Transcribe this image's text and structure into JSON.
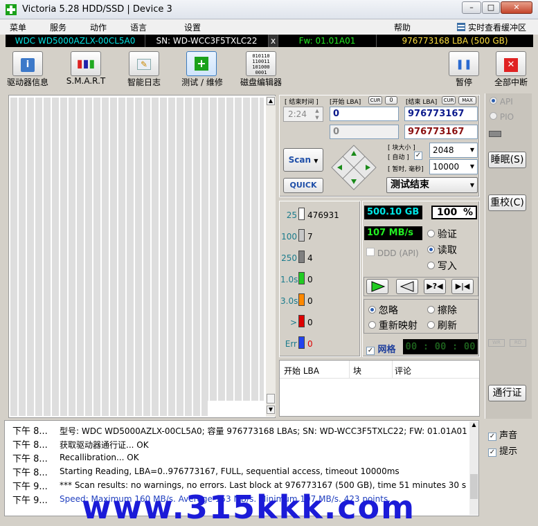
{
  "window": {
    "title": "Victoria 5.28 HDD/SSD | Device 3",
    "min": "–",
    "max": "□",
    "close": "✕"
  },
  "menu": {
    "items": [
      "菜单",
      "服务",
      "动作",
      "语言",
      "设置",
      "帮助"
    ],
    "right": "实时查看缓冲区"
  },
  "infobar": {
    "model": "WDC WD5000AZLX-00CL5A0",
    "serial": "SN: WD-WCC3F5TXLC22",
    "x": "x",
    "fw": "Fw: 01.01A01",
    "lba": "976773168 LBA (500 GB)"
  },
  "toolbar": {
    "drive_info": "驱动器信息",
    "smart": "S.M.A.R.T",
    "smart_log": "智能日志",
    "test": "测试 / 维修",
    "disk_editor": "磁盘编辑器",
    "pause": "暂停",
    "abort": "全部中断"
  },
  "params": {
    "end_time_label": "[ 结束时间 ]",
    "end_time": "2:24",
    "start_lba_label": "[开始 LBA]",
    "cur": "CUR",
    "zero": "0",
    "end_lba_label": "[结束 LBA]",
    "cur2": "CUR",
    "max": "MAX",
    "start_lba": "0",
    "end_lba": "976773167",
    "start_lba2": "0",
    "end_lba2": "976773167",
    "block_size_label": "[ 块大小 ]",
    "auto_label": "[ 自动 ]",
    "block_size": "2048",
    "timeout_label": "[ 暂时, 毫秒]",
    "timeout": "10000",
    "scan": "Scan",
    "quick": "QUICK",
    "status": "测试结束"
  },
  "stats": {
    "rows": [
      {
        "label": "25",
        "count": "476931",
        "color": "#ffffff"
      },
      {
        "label": "100",
        "count": "7",
        "color": "#c8c8c8"
      },
      {
        "label": "250",
        "count": "4",
        "color": "#808080"
      },
      {
        "label": "1.0s",
        "count": "0",
        "color": "#22cc22"
      },
      {
        "label": "3.0s",
        "count": "0",
        "color": "#ff8800"
      },
      {
        "label": ">",
        "count": "0",
        "color": "#dd0000"
      },
      {
        "label": "Err",
        "count": "0",
        "color": "#2244ee"
      }
    ],
    "size": "500.10 GB",
    "percent": "100",
    "percent_unit": "%",
    "speed": "107 MB/s",
    "ddd": "DDD (API)",
    "verify": "验证",
    "read": "读取",
    "write": "写入",
    "ignore": "忽略",
    "erase": "擦除",
    "remap": "重新映射",
    "refresh": "刷新",
    "grid_label": "网格",
    "timer": "00 : 00 : 00"
  },
  "results_table": {
    "columns": [
      "开始 LBA",
      "块",
      "评论"
    ]
  },
  "side": {
    "api": "API",
    "pio": "PIO",
    "sleep": "睡眠(S)",
    "recal": "重校(C)",
    "wr": "WR",
    "rd": "RD",
    "passport": "通行证"
  },
  "log": {
    "rows": [
      {
        "time": "下午 8...",
        "text": "型号: WDC WD5000AZLX-00CL5A0; 容量 976773168 LBAs; SN: WD-WCC3F5TXLC22; FW: 01.01A01"
      },
      {
        "time": "下午 8...",
        "text": "获取驱动器通行证... OK"
      },
      {
        "time": "下午 8...",
        "text": "Recallibration... OK"
      },
      {
        "time": "下午 8...",
        "text": "Starting Reading, LBA=0..976773167, FULL, sequential access, timeout 10000ms"
      },
      {
        "time": "下午 9...",
        "text": "*** Scan results: no warnings, no errors. Last block at 976773167 (500 GB), time 51 minutes 30 s..."
      },
      {
        "time": "下午 9...",
        "text": "Speed: Maximum 160 MB/s. Average 153 MB/s. Minimum 107 MB/s. 423 points."
      }
    ],
    "sound": "声音",
    "hints": "提示"
  },
  "watermark": "www.315kkk.com"
}
